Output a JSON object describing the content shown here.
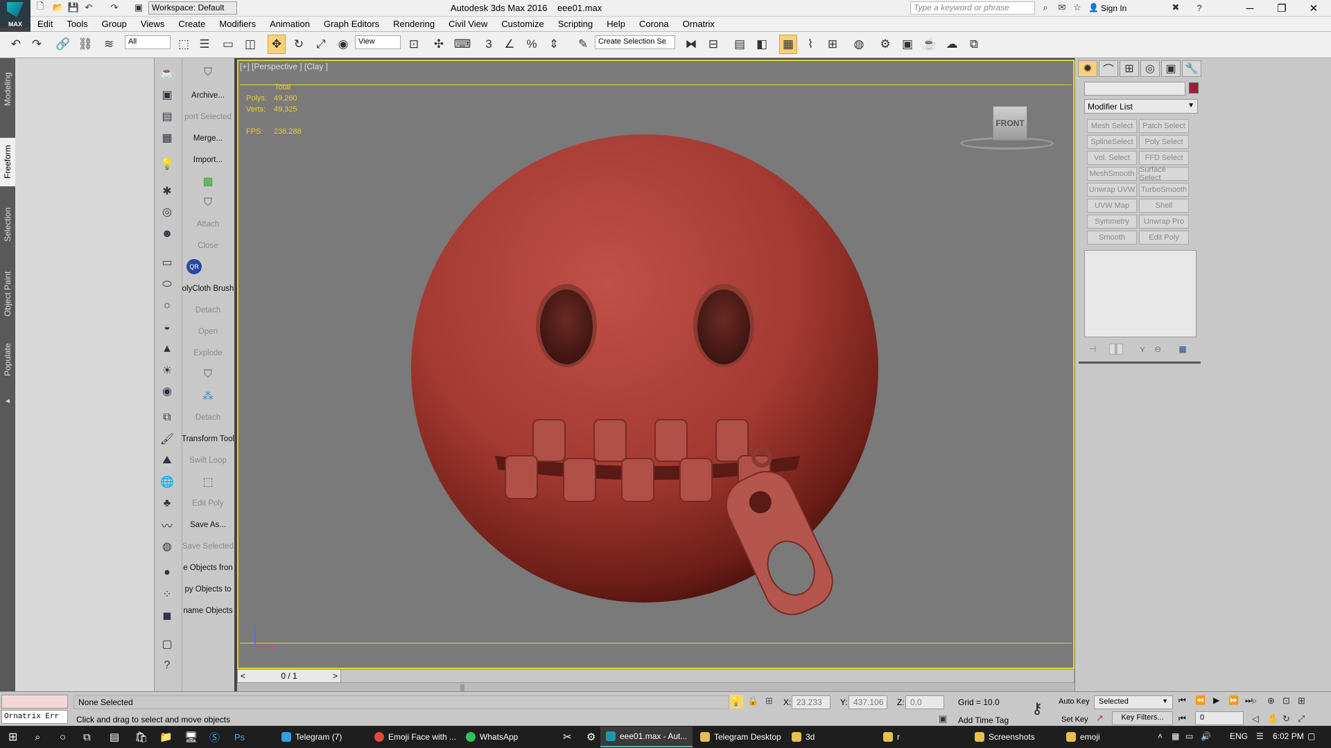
{
  "window": {
    "app_title": "Autodesk 3ds Max 2016",
    "file_name": "eee01.max",
    "workspace": "Workspace: Default",
    "search_placeholder": "Type a keyword or phrase",
    "sign_in": "Sign In",
    "logo_text": "MAX"
  },
  "menu": [
    "Edit",
    "Tools",
    "Group",
    "Views",
    "Create",
    "Modifiers",
    "Animation",
    "Graph Editors",
    "Rendering",
    "Civil View",
    "Customize",
    "Scripting",
    "Help",
    "Corona",
    "Ornatrix"
  ],
  "toolbar": {
    "selection_filter": "All",
    "ref_coord": "View",
    "selection_set": "Create Selection Se",
    "snap_label": "3"
  },
  "left_tabs": [
    "Modeling",
    "Freeform",
    "Selection",
    "Object Paint",
    "Populate"
  ],
  "script_panel": [
    {
      "label": "Archive...",
      "enabled": true
    },
    {
      "label": "port Selected",
      "enabled": false
    },
    {
      "label": "Merge...",
      "enabled": true
    },
    {
      "label": "Import...",
      "enabled": true
    },
    {
      "label": "Attach",
      "enabled": false
    },
    {
      "label": "Close",
      "enabled": false
    },
    {
      "label": "QR",
      "enabled": true
    },
    {
      "label": "olyCloth Brush",
      "enabled": true
    },
    {
      "label": "Detach",
      "enabled": false
    },
    {
      "label": "Open",
      "enabled": false
    },
    {
      "label": "Explode",
      "enabled": false
    },
    {
      "label": "Detach",
      "enabled": false
    },
    {
      "label": "Transform Tool",
      "enabled": true
    },
    {
      "label": "Swift Loop",
      "enabled": false
    },
    {
      "label": "Edit Poly",
      "enabled": false
    },
    {
      "label": "Save As...",
      "enabled": true
    },
    {
      "label": "Save Selected",
      "enabled": false
    },
    {
      "label": "e Objects fron",
      "enabled": true
    },
    {
      "label": "py Objects to",
      "enabled": true
    },
    {
      "label": "name Objects",
      "enabled": true
    }
  ],
  "viewport": {
    "label": "[+] [Perspective ] [Clay ]",
    "stats_header": "Total",
    "polys_label": "Polys:",
    "polys": "49,260",
    "verts_label": "Verts:",
    "verts": "49,325",
    "fps_label": "FPS:",
    "fps": "238.288",
    "viewcube": "FRONT",
    "axis_z": "z",
    "axis_x": "x"
  },
  "timeline": {
    "frame": "0 / 1",
    "prev": "<",
    "next": ">"
  },
  "command_panel": {
    "modifier_list": "Modifier List",
    "buttons": [
      "Mesh Select",
      "Patch Select",
      "SplineSelect",
      "Poly Select",
      "Vol. Select",
      "FFD Select",
      "MeshSmooth",
      "Surface Select",
      "Unwrap UVW",
      "TurboSmooth",
      "UVW Map",
      "Shell",
      "Symmetry",
      "Unwrap Pro",
      "Smooth",
      "Edit Poly"
    ],
    "swatch_color": "#a01a3c"
  },
  "status": {
    "maxscript": "Ornatrix Err",
    "selection": "None Selected",
    "prompt": "Click and drag to select and move objects",
    "x_label": "X:",
    "x": "23.233",
    "y_label": "Y:",
    "y": "437.106",
    "z_label": "Z:",
    "z": "0.0",
    "grid": "Grid = 10.0",
    "add_time_tag": "Add Time Tag",
    "auto_key": "Auto Key",
    "set_key": "Set Key",
    "key_mode": "Selected",
    "key_filters": "Key Filters...",
    "current_frame": "0"
  },
  "taskbar": {
    "items": [
      "Telegram (7)",
      "Emoji Face with ...",
      "WhatsApp",
      "eee01.max - Aut...",
      "Telegram Desktop",
      "3d",
      "r",
      "Screenshots",
      "emoji"
    ],
    "lang": "ENG",
    "time": "6:02 PM"
  }
}
